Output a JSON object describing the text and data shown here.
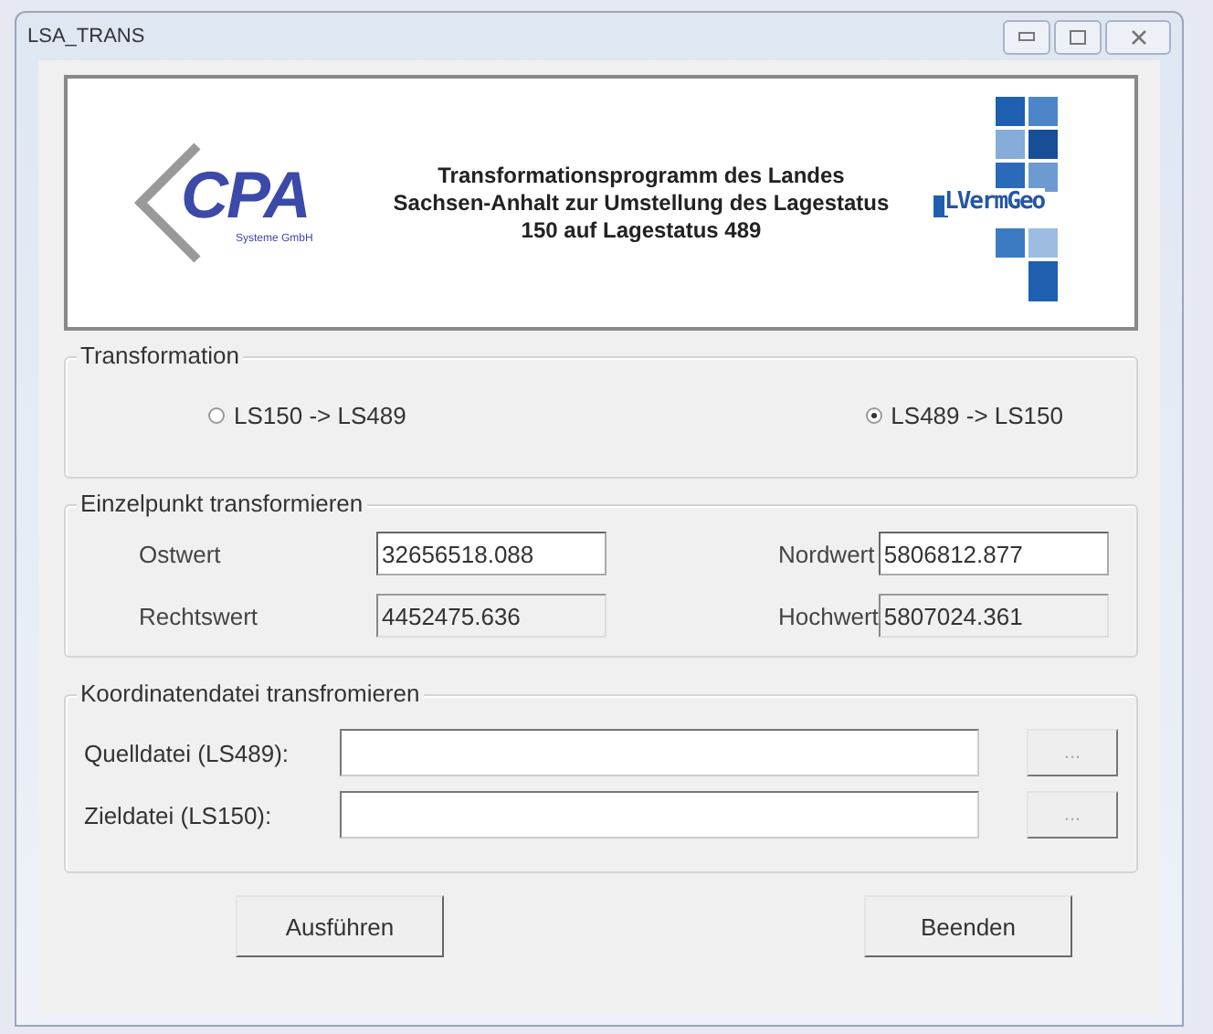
{
  "window": {
    "title": "LSA_TRANS"
  },
  "banner": {
    "left_logo": {
      "text": "CPA",
      "subtext": "Systeme GmbH"
    },
    "heading": "Transformationsprogramm des Landes Sachsen-Anhalt zur Umstellung des Lagestatus 150 auf Lagestatus 489",
    "right_logo": {
      "text": "LVermGeo"
    }
  },
  "transformation": {
    "title": "Transformation",
    "options": [
      {
        "label": "LS150 -> LS489",
        "selected": false
      },
      {
        "label": "LS489 -> LS150",
        "selected": true
      }
    ]
  },
  "single_point": {
    "title": "Einzelpunkt transformieren",
    "fields": [
      {
        "label": "Ostwert",
        "value": "32656518.088",
        "readonly": false
      },
      {
        "label": "Nordwert",
        "value": "5806812.877",
        "readonly": false
      },
      {
        "label": "Rechtswert",
        "value": "4452475.636",
        "readonly": true
      },
      {
        "label": "Hochwert",
        "value": "5807024.361",
        "readonly": true
      }
    ]
  },
  "file": {
    "title": "Koordinatendatei transfromieren",
    "rows": [
      {
        "label": "Quelldatei (LS489):",
        "browse": "..."
      },
      {
        "label": "Zieldatei (LS150):",
        "browse": "..."
      }
    ]
  },
  "buttons": [
    "Ausführen",
    "Beenden"
  ]
}
